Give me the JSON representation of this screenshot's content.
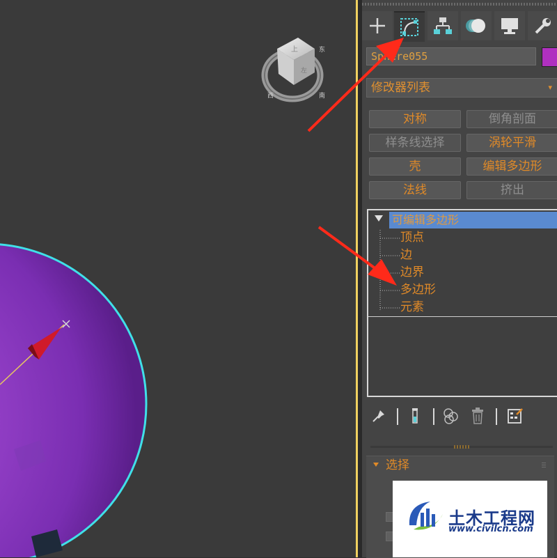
{
  "object": {
    "name": "Sphere055",
    "color": "#b030c0"
  },
  "modifier_list": {
    "label": "修改器列表",
    "arrow": "▾"
  },
  "modifier_buttons": [
    {
      "label": "对称",
      "enabled": true
    },
    {
      "label": "倒角剖面",
      "enabled": false
    },
    {
      "label": "样条线选择",
      "enabled": false
    },
    {
      "label": "涡轮平滑",
      "enabled": true
    },
    {
      "label": "壳",
      "enabled": true
    },
    {
      "label": "编辑多边形",
      "enabled": true
    },
    {
      "label": "法线",
      "enabled": true
    },
    {
      "label": "挤出",
      "enabled": false
    }
  ],
  "stack": {
    "top_item": "可编辑多边形",
    "sub_objects": [
      "顶点",
      "边",
      "边界",
      "多边形",
      "元素"
    ]
  },
  "tabs": [
    {
      "icon": "create-plus-icon"
    },
    {
      "icon": "modify-icon"
    },
    {
      "icon": "hierarchy-icon"
    },
    {
      "icon": "motion-icon"
    },
    {
      "icon": "display-icon"
    },
    {
      "icon": "utilities-wrench-icon"
    }
  ],
  "stack_tools": [
    {
      "icon": "pin-stack-icon"
    },
    {
      "icon": "show-end-result-icon"
    },
    {
      "icon": "make-unique-icon"
    },
    {
      "icon": "remove-modifier-icon"
    },
    {
      "icon": "configure-sets-icon"
    }
  ],
  "rollout": {
    "title": "选择"
  },
  "watermark": {
    "name": "土木工程网",
    "url": "www.civilcn.com"
  },
  "colors": {
    "accent_text": "#e08a28",
    "selection_blue": "#5a8ad0",
    "sphere": "#8e3ec0",
    "selection_outline": "#40e0e8",
    "annotation_arrow": "#ff2a1a"
  }
}
